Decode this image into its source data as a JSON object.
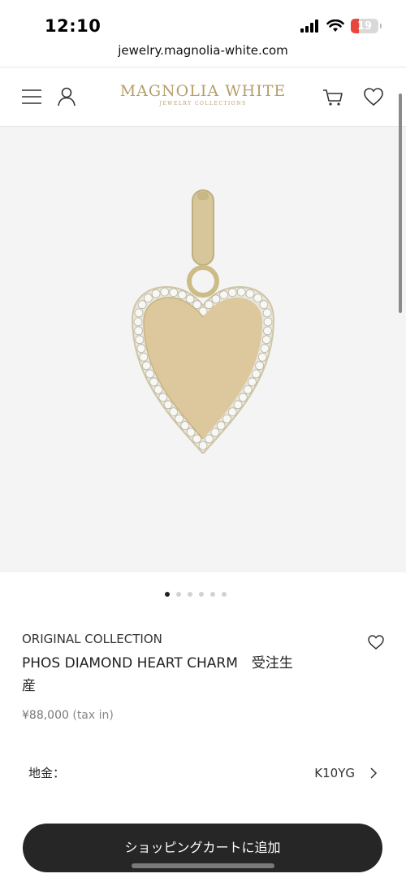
{
  "status_bar": {
    "time": "12:10",
    "battery": "19"
  },
  "browser": {
    "url": "jewelry.magnolia-white.com"
  },
  "header": {
    "logo_main": "MAGNOLIA WHITE",
    "logo_sub": "JEWELRY COLLECTIONS",
    "icons": [
      "menu-icon",
      "account-icon",
      "cart-icon",
      "heart-icon"
    ]
  },
  "gallery": {
    "slide_count": 6,
    "active_index": 0
  },
  "product": {
    "collection": "ORIGINAL COLLECTION",
    "title": "PHOS DIAMOND HEART CHARM　受注生産",
    "price": "¥88,000",
    "price_note": "(tax in)",
    "material_label": "地金：",
    "material_value": "K10YG"
  },
  "cta": {
    "label": "ショッピングカートに追加"
  },
  "colors": {
    "brand_gold": "#b59f6a",
    "cta_bg": "#262626",
    "image_bg": "#f4f4f4"
  }
}
